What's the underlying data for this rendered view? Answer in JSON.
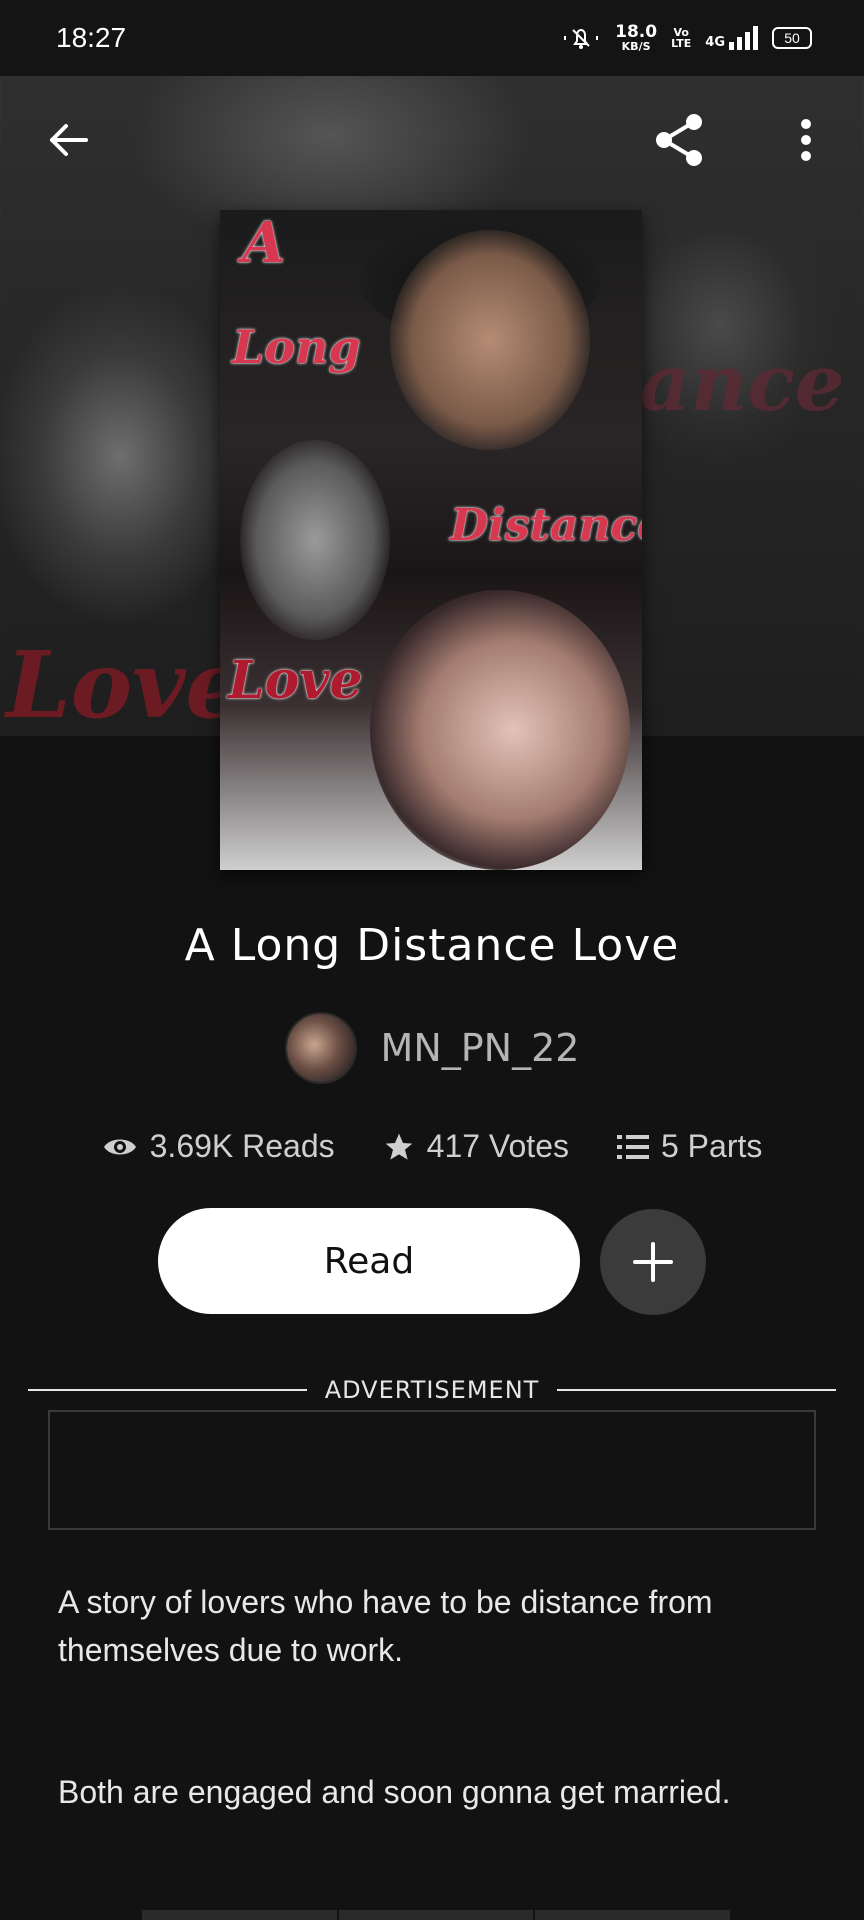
{
  "status_bar": {
    "time": "18:27",
    "speed_value": "18.0",
    "speed_unit": "KB/S",
    "volte_top": "Vo",
    "volte_bottom": "LTE",
    "network": "4G",
    "battery": "50"
  },
  "cover_text": {
    "line1": "A",
    "line2": "Long",
    "line3": "Distance",
    "line4": "Love",
    "bg_left": "Love",
    "bg_right": "ance"
  },
  "story": {
    "title": "A Long Distance Love",
    "author": "MN_PN_22"
  },
  "stats": {
    "reads": "3.69K Reads",
    "votes": "417 Votes",
    "parts": "5 Parts"
  },
  "actions": {
    "read_label": "Read"
  },
  "ad": {
    "label": "ADVERTISEMENT"
  },
  "description": {
    "p1": "A story of lovers who have to be distance from themselves due to work.",
    "p2": "Both are engaged and soon gonna get married."
  },
  "icons": {
    "back": "arrow-left-icon",
    "share": "share-icon",
    "more": "more-vertical-icon",
    "reads": "eye-icon",
    "votes": "star-icon",
    "parts": "list-icon",
    "add": "plus-icon"
  }
}
